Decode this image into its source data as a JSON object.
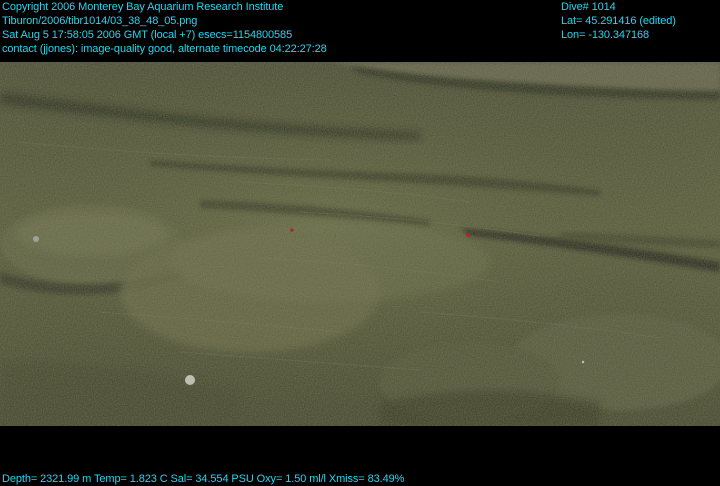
{
  "header": {
    "left_lines": [
      "Copyright 2006 Monterey Bay Aquarium Research Institute",
      "Tiburon/2006/tibr1014/03_38_48_05.png",
      "Sat Aug  5 17:58:05 2006 GMT (local +7)  esecs=1154800585",
      "contact (jjones): image-quality good, alternate timecode 04:22:27:28"
    ],
    "right_lines": [
      "Dive# 1014",
      "Lat= 45.291416 (edited)",
      "Lon= -130.347168"
    ]
  },
  "footer": {
    "telemetry": "Depth= 2321.99 m  Temp= 1.823 C  Sal= 34.554 PSU  Oxy= 1.50 ml/l  Xmiss= 83.49%"
  },
  "colors": {
    "overlay_text": "#22d8ee",
    "background": "#000000",
    "seafloor": "#4e5135"
  }
}
